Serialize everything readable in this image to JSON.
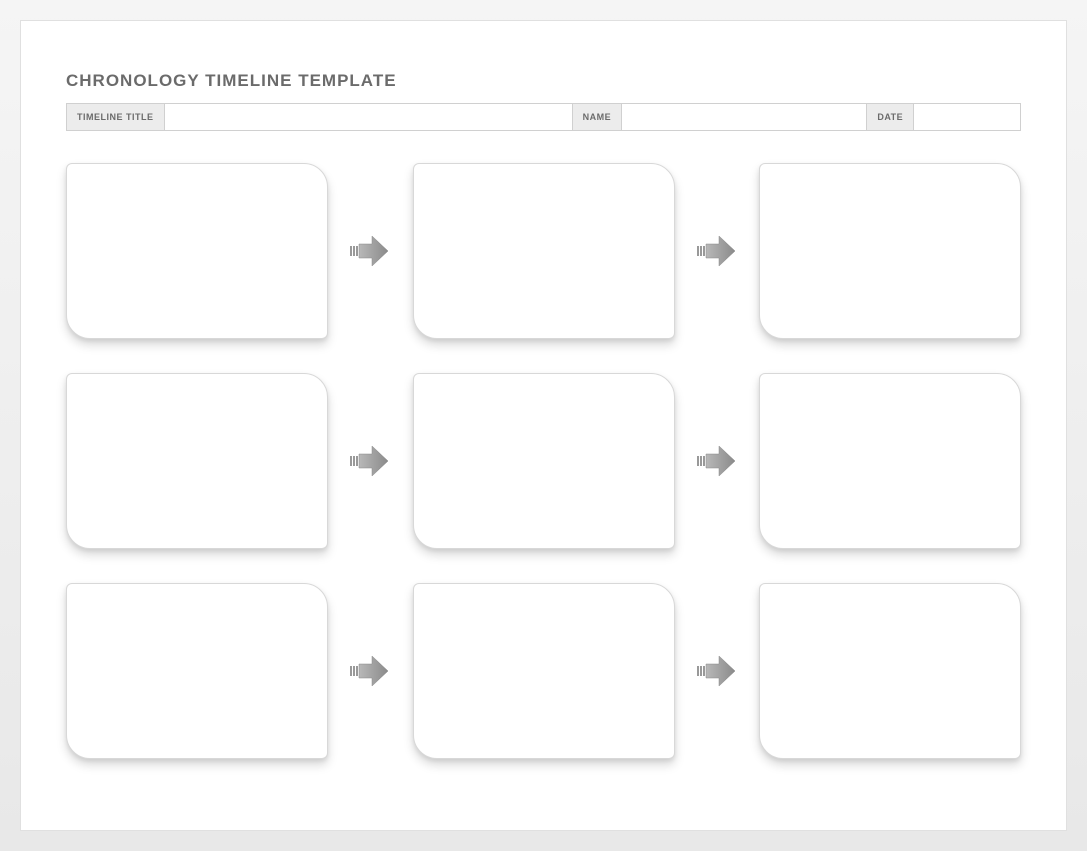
{
  "title": "CHRONOLOGY TIMELINE TEMPLATE",
  "header": {
    "timeline_title_label": "TIMELINE TITLE",
    "timeline_title_value": "",
    "name_label": "NAME",
    "name_value": "",
    "date_label": "DATE",
    "date_value": ""
  },
  "rows": [
    {
      "boxes": [
        "",
        "",
        ""
      ]
    },
    {
      "boxes": [
        "",
        "",
        ""
      ]
    },
    {
      "boxes": [
        "",
        "",
        ""
      ]
    }
  ]
}
